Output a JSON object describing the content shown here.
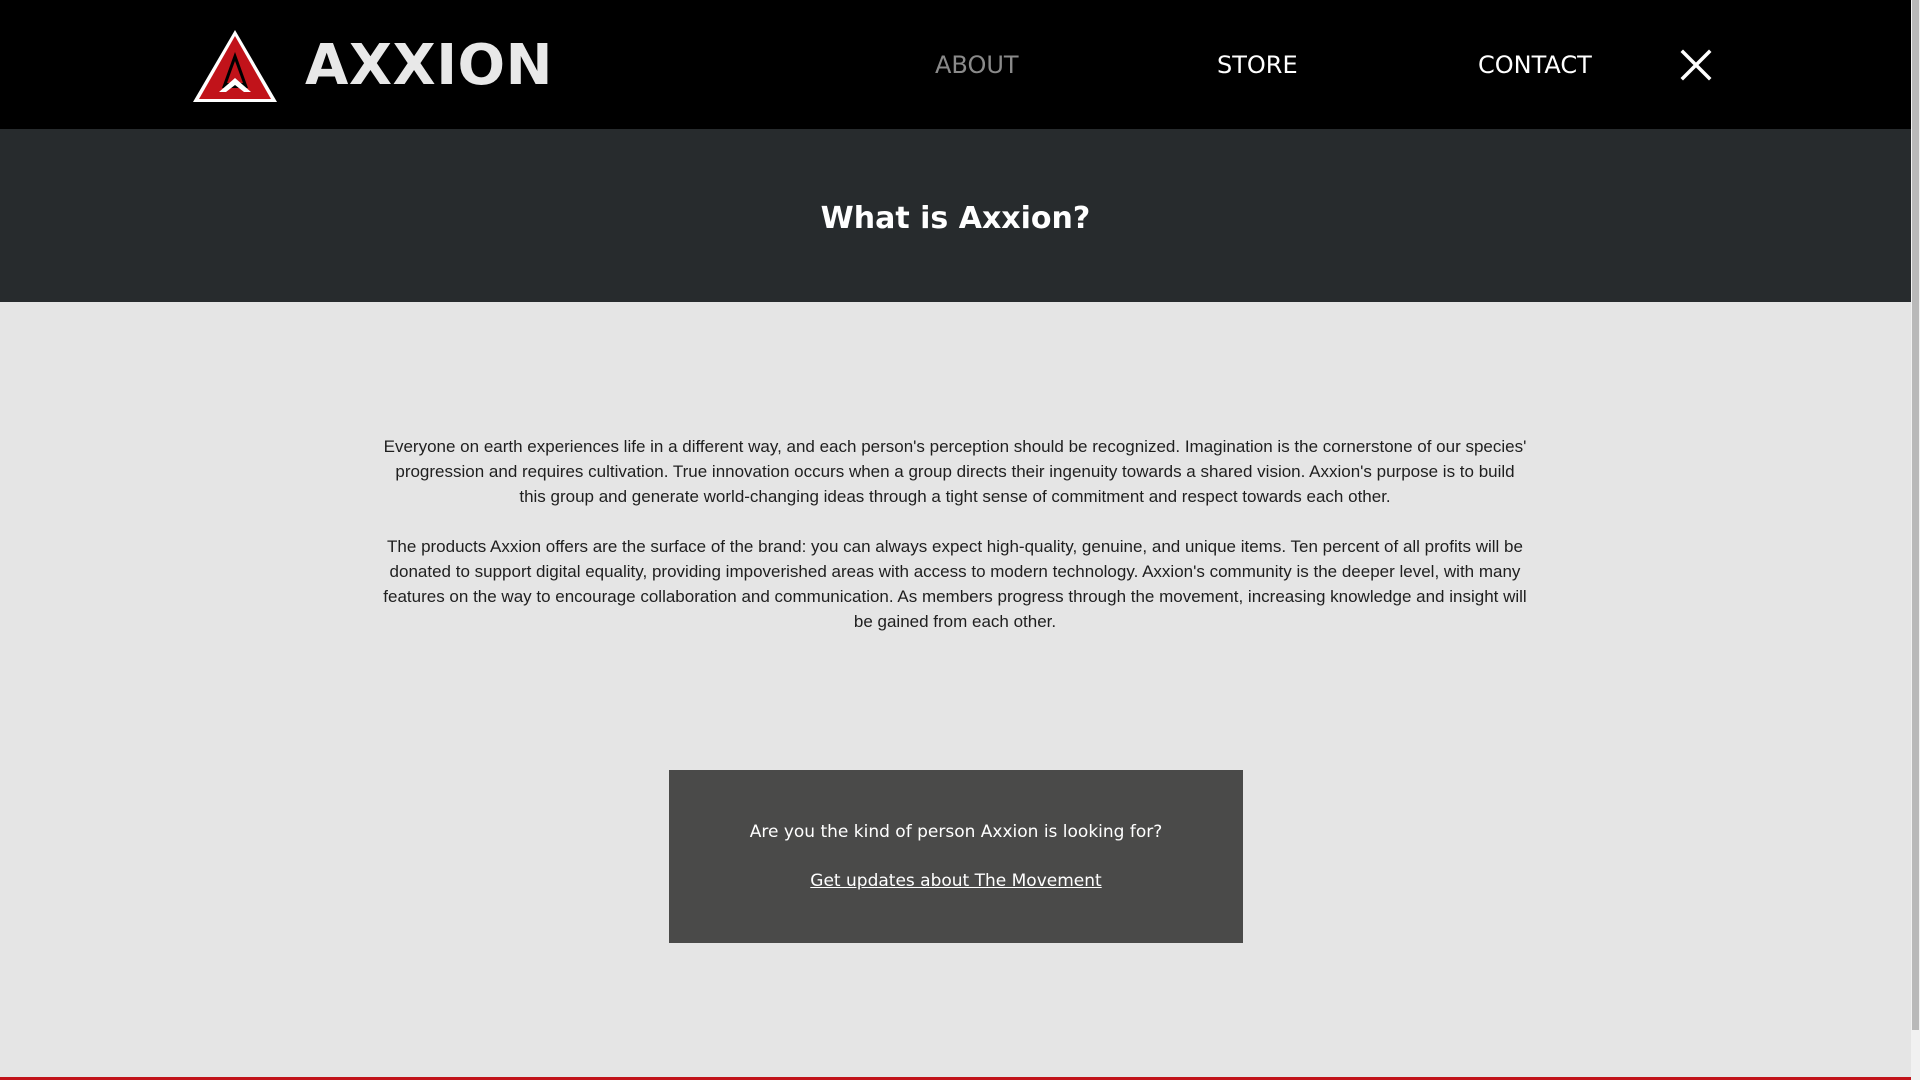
{
  "brand": {
    "name": "AXXION",
    "logo_icon": "axxion-a-logo-icon",
    "accent_color": "#c1131a"
  },
  "nav": {
    "items": [
      {
        "label": "ABOUT",
        "active": true
      },
      {
        "label": "STORE",
        "active": false
      },
      {
        "label": "CONTACT",
        "active": false
      }
    ],
    "close_icon": "close-icon"
  },
  "hero": {
    "title": "What is Axxion?"
  },
  "about": {
    "paragraphs": [
      "Everyone on earth experiences life in a different way, and each person's perception should be recognized. Imagination is the cornerstone of our species' progression and requires cultivation. True innovation occurs when a group directs their ingenuity towards a shared vision. Axxion's purpose is to build this group and generate world-changing ideas through a tight sense of commitment and respect towards each other.",
      "The products Axxion offers are the surface of the brand: you can always expect high-quality, genuine, and unique items. Ten percent of all profits will be donated to support digital equality, providing impoverished areas with access to modern technology. Axxion's community is the deeper level, with many features on the way to encourage collaboration and communication. As members progress through the movement, increasing knowledge and insight will be gained from each other."
    ]
  },
  "cta": {
    "question": "Are you the kind of person Axxion is looking for?",
    "link_label": "Get updates about The Movement"
  },
  "colors": {
    "header_bg": "#000000",
    "title_band_bg": "#272b2d",
    "page_bg": "#e5e5e5",
    "cta_bg": "#4a4a49",
    "nav_active": "#8a8a8a"
  }
}
